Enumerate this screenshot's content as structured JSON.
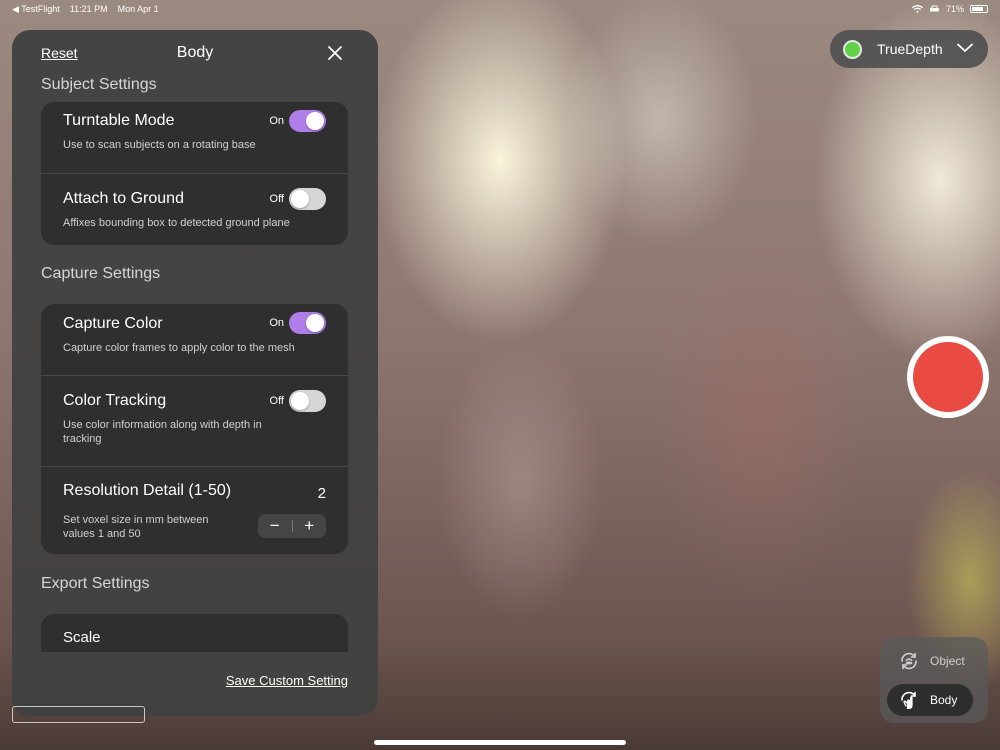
{
  "status_bar": {
    "back_app": "◀ TestFlight",
    "time": "11:21 PM",
    "date": "Mon Apr 1",
    "battery": "71%"
  },
  "panel": {
    "reset_label": "Reset",
    "title": "Body",
    "close_icon": "close-icon",
    "subject_section": {
      "title": "Subject Settings",
      "rows": [
        {
          "title": "Turntable Mode",
          "description": "Use to scan subjects on a rotating base",
          "toggle_label": "On",
          "on": true
        },
        {
          "title": "Attach to Ground",
          "description": "Affixes bounding box to detected ground plane",
          "toggle_label": "Off",
          "on": false
        }
      ]
    },
    "capture_section": {
      "title": "Capture Settings",
      "rows": [
        {
          "title": "Capture Color",
          "description": "Capture color frames to apply color to the mesh",
          "toggle_label": "On",
          "on": true
        },
        {
          "title": "Color Tracking",
          "description": "Use color information along with depth in tracking",
          "toggle_label": "Off",
          "on": false
        }
      ],
      "resolution": {
        "title": "Resolution Detail (1-50)",
        "value": "2",
        "description": "Set voxel size in mm between values 1 and 50",
        "decrement": "−",
        "increment": "+"
      }
    },
    "export_section": {
      "title": "Export Settings",
      "rows": [
        {
          "title": "Scale"
        }
      ]
    },
    "save_label": "Save Custom Setting"
  },
  "camera_selector": {
    "label": "TrueDepth",
    "status_color": "#5fd24a",
    "chevron_icon": "chevron-down-icon"
  },
  "record_button": {
    "color": "#e94b43"
  },
  "mode_selector": {
    "items": [
      {
        "label": "Object",
        "icon": "object-rotate-icon",
        "active": false
      },
      {
        "label": "Body",
        "icon": "body-rotate-icon",
        "active": true
      }
    ]
  },
  "accent_color": "#b07ee8"
}
